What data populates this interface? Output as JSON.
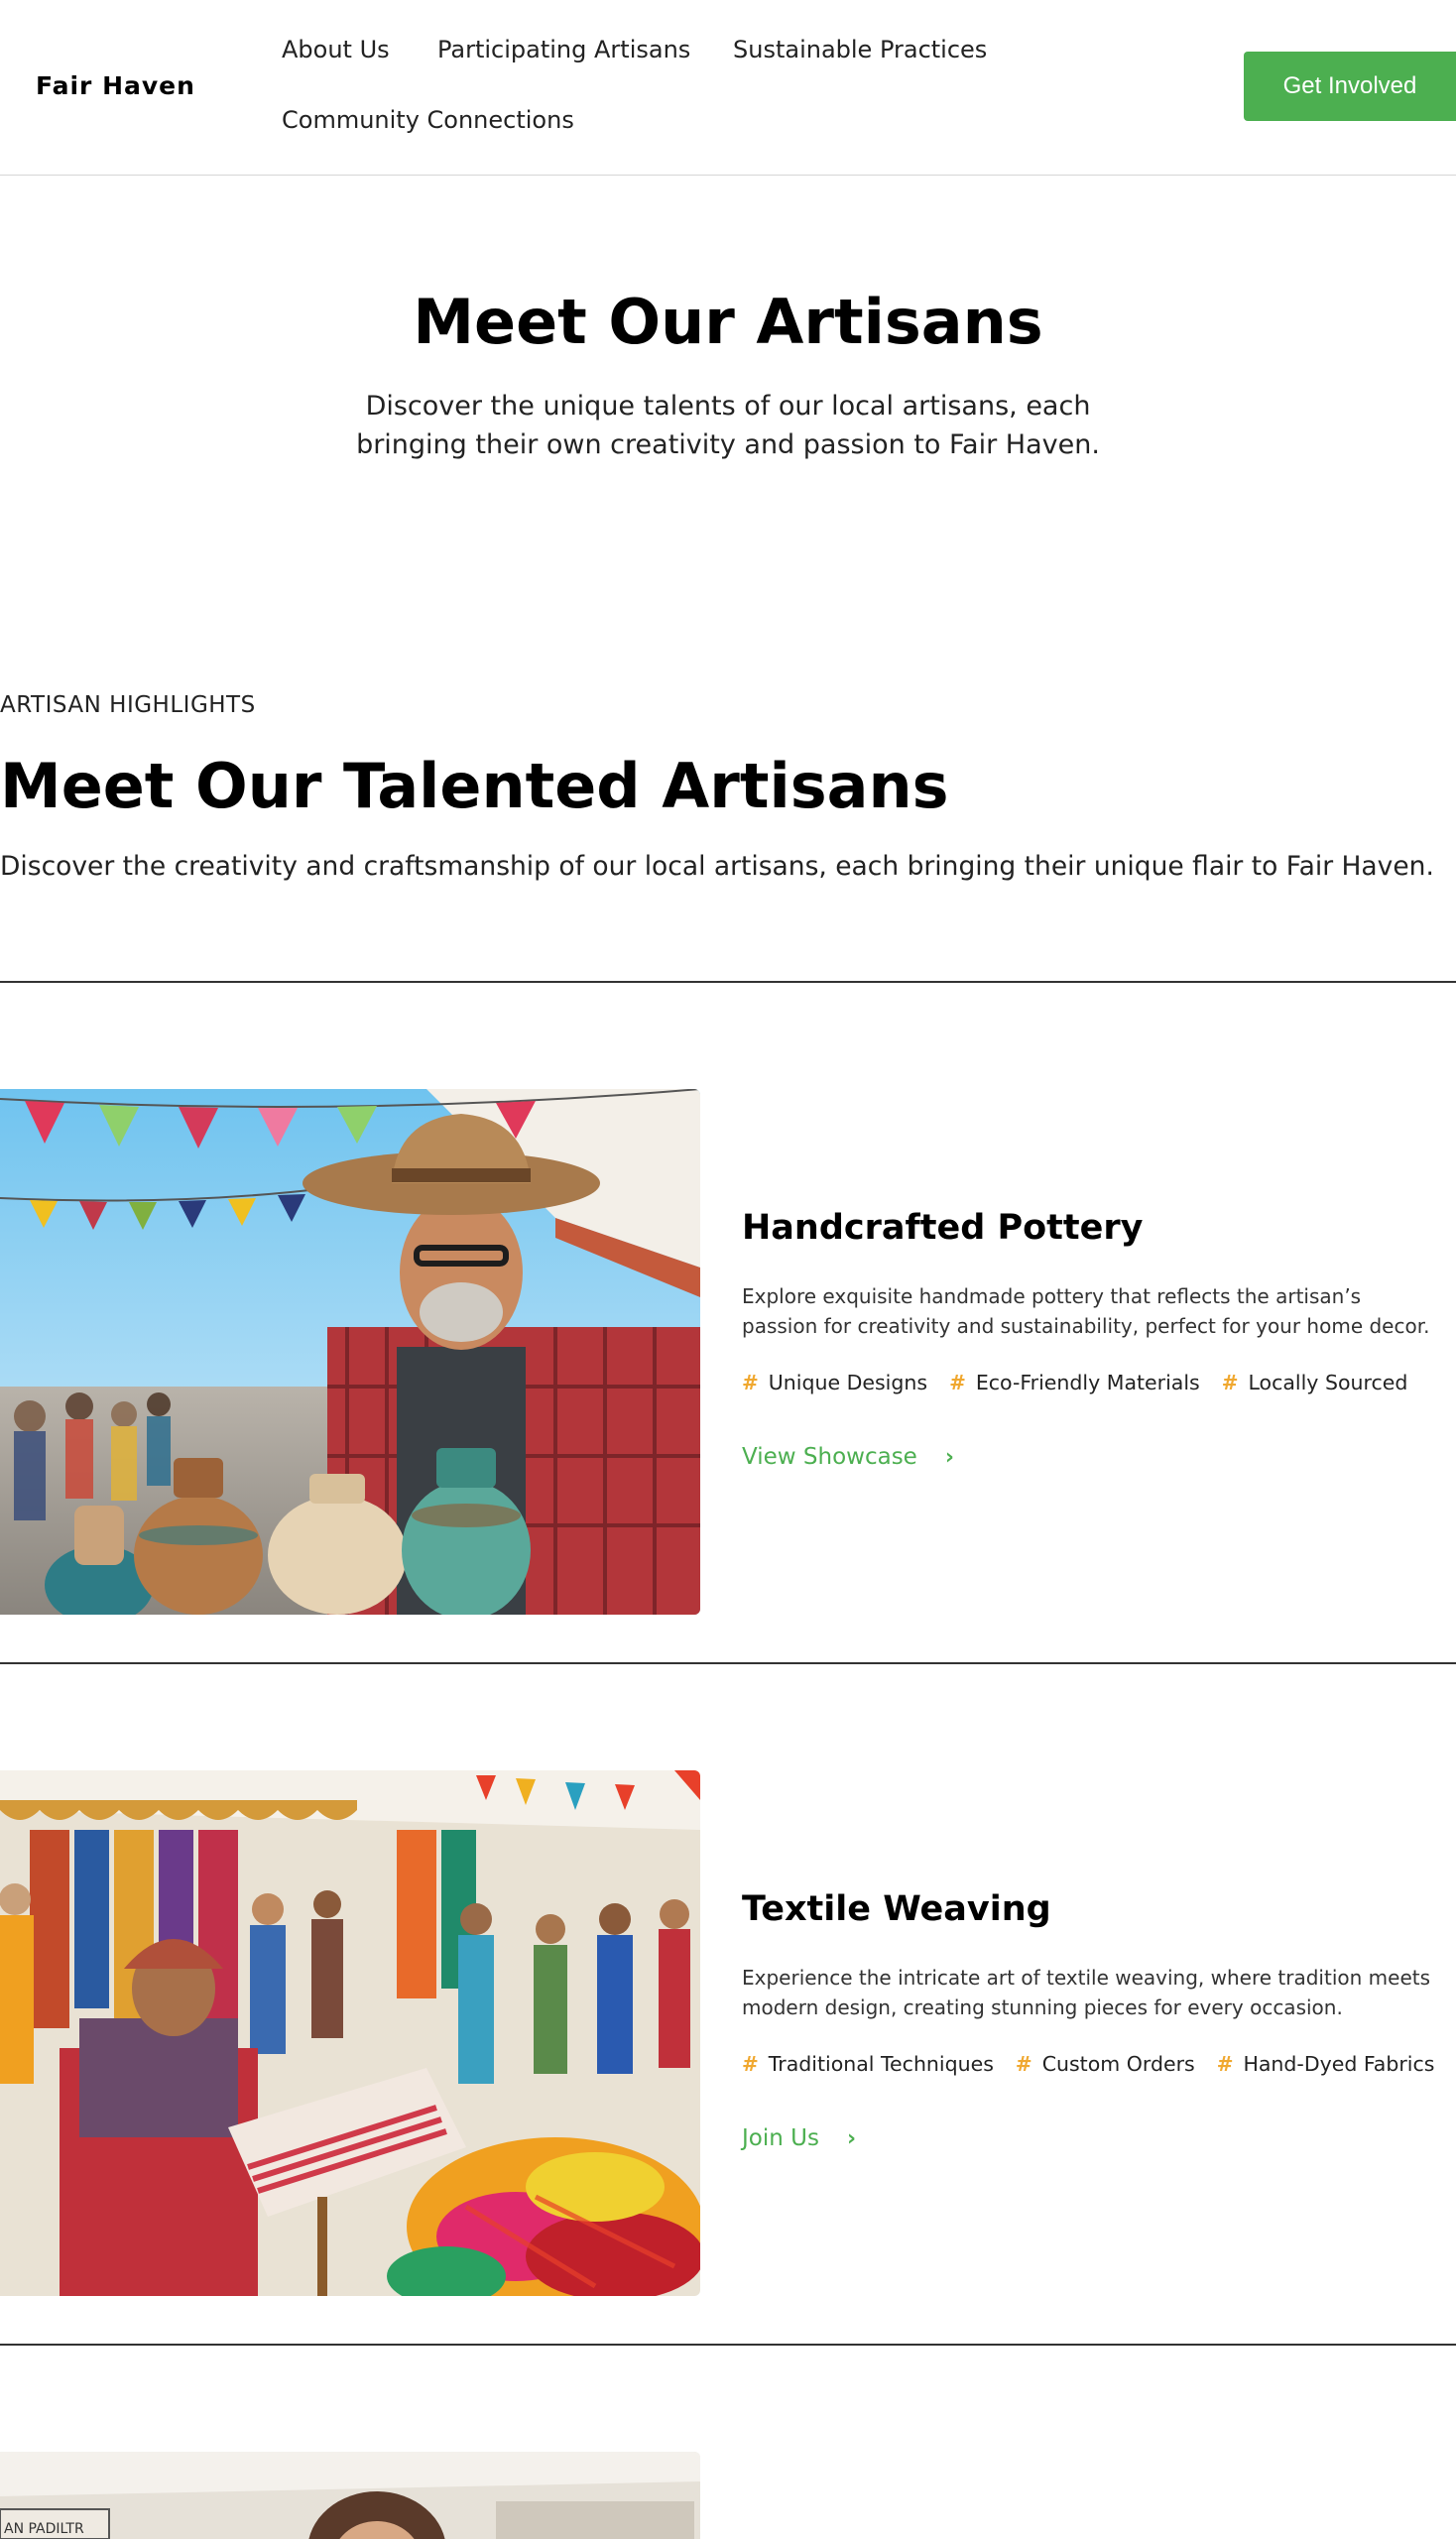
{
  "header": {
    "logo": "Fair Haven",
    "nav": [
      "About Us",
      "Participating Artisans",
      "Sustainable Practices",
      "Community Connections"
    ],
    "cta": "Get Involved"
  },
  "hero": {
    "title": "Meet Our Artisans",
    "subtitle": "Discover the unique talents of our local artisans, each bringing their own creativity and passion to Fair Haven."
  },
  "section": {
    "eyebrow": "ARTISAN HIGHLIGHTS",
    "title": "Meet Our Talented Artisans",
    "subtitle": "Discover the creativity and craftsmanship of our local artisans, each bringing their unique flair to Fair Haven."
  },
  "cards": [
    {
      "title": "Handcrafted Pottery",
      "description": "Explore exquisite handmade pottery that reflects the artisan’s passion for creativity and sustainability, perfect for your home decor.",
      "tags": [
        "Unique Designs",
        "Eco-Friendly Materials",
        "Locally Sourced"
      ],
      "link": "View Showcase",
      "image": "potter-at-market-photo"
    },
    {
      "title": "Textile Weaving",
      "description": "Experience the intricate art of textile weaving, where tradition meets modern design, creating stunning pieces for every occasion.",
      "tags": [
        "Traditional Techniques",
        "Custom Orders",
        "Hand-Dyed Fabrics"
      ],
      "link": "Join Us",
      "image": "weaver-at-market-photo"
    }
  ],
  "third_card": {
    "image_label": "AN PADILTR"
  },
  "colors": {
    "accent": "#4caf50",
    "tag_hash": "#f0a830",
    "text": "#111111"
  }
}
